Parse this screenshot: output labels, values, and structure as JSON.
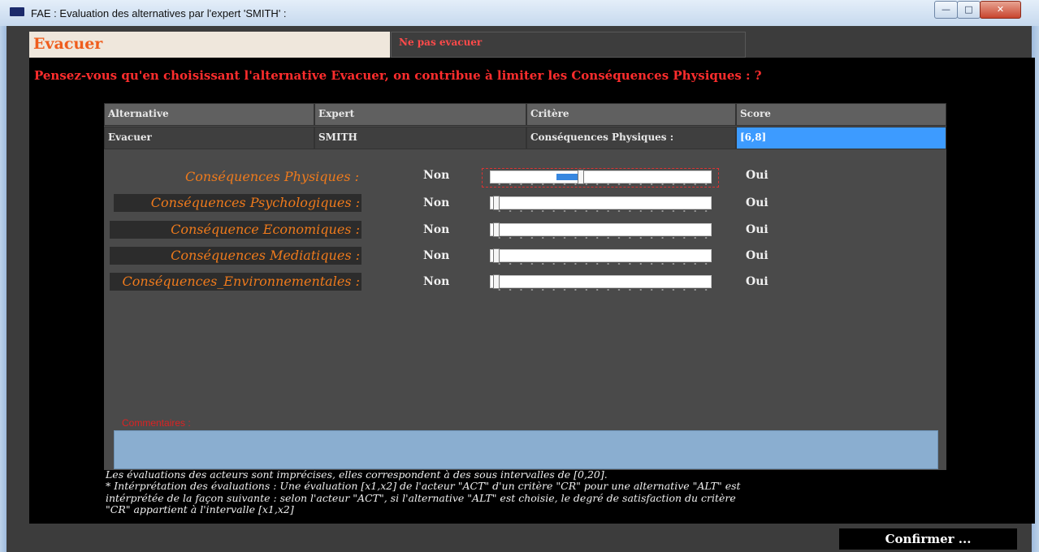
{
  "window": {
    "title": "FAE : Evaluation des alternatives par l'expert 'SMITH' :",
    "controls": {
      "minimize": "—",
      "maximize": "□",
      "close": "✕"
    }
  },
  "tabs": [
    {
      "label": "Evacuer",
      "active": true
    },
    {
      "label": "Ne pas evacuer",
      "active": false
    }
  ],
  "question": "Pensez-vous qu'en choisissant l'alternative Evacuer, on contribue à limiter les Conséquences Physiques :  ?",
  "table": {
    "headers": [
      "Alternative",
      "Expert",
      "Critère",
      "Score"
    ],
    "row": [
      "Evacuer",
      "SMITH",
      "Conséquences Physiques :",
      "[6,8]"
    ]
  },
  "criteria": [
    {
      "label": "Conséquences Physiques :",
      "min_label": "Non",
      "max_label": "Oui",
      "range": [
        6,
        8
      ],
      "scale": [
        0,
        20
      ]
    },
    {
      "label": "Conséquences Psychologiques :",
      "min_label": "Non",
      "max_label": "Oui",
      "range": [
        0,
        0
      ],
      "scale": [
        0,
        20
      ]
    },
    {
      "label": "Conséquence Economiques :",
      "min_label": "Non",
      "max_label": "Oui",
      "range": [
        0,
        0
      ],
      "scale": [
        0,
        20
      ]
    },
    {
      "label": "Conséquences Mediatiques :",
      "min_label": "Non",
      "max_label": "Oui",
      "range": [
        0,
        0
      ],
      "scale": [
        0,
        20
      ]
    },
    {
      "label": "Conséquences_Environnementales :",
      "min_label": "Non",
      "max_label": "Oui",
      "range": [
        0,
        0
      ],
      "scale": [
        0,
        20
      ]
    }
  ],
  "comments": {
    "label": "Commentaires :",
    "value": ""
  },
  "note_lines": [
    "Les évaluations des acteurs sont imprécises, elles correspondent à des sous intervalles  de [0,20].",
    "* Intérprétation des évaluations : Une évaluation [x1,x2] de l'acteur \"ACT\" d'un critère \"CR\" pour une alternative \"ALT\" est",
    "intérprétée de la façon suivante : selon l'acteur \"ACT\", si l'alternative \"ALT\" est choisie, le degré de satisfaction du critère",
    "\"CR\"  appartient à   l'intervalle [x1,x2]"
  ],
  "confirm_label": "Confirmer ...",
  "colors": {
    "accent_orange": "#ef5d1d",
    "criterion_orange": "#ee7a1c",
    "question_red": "#ff2d2d",
    "selected_blue": "#3d9bff",
    "slider_fill": "#3787e0",
    "comments_bg": "#8aaed0"
  },
  "icons": {
    "app": "app-window-icon"
  }
}
